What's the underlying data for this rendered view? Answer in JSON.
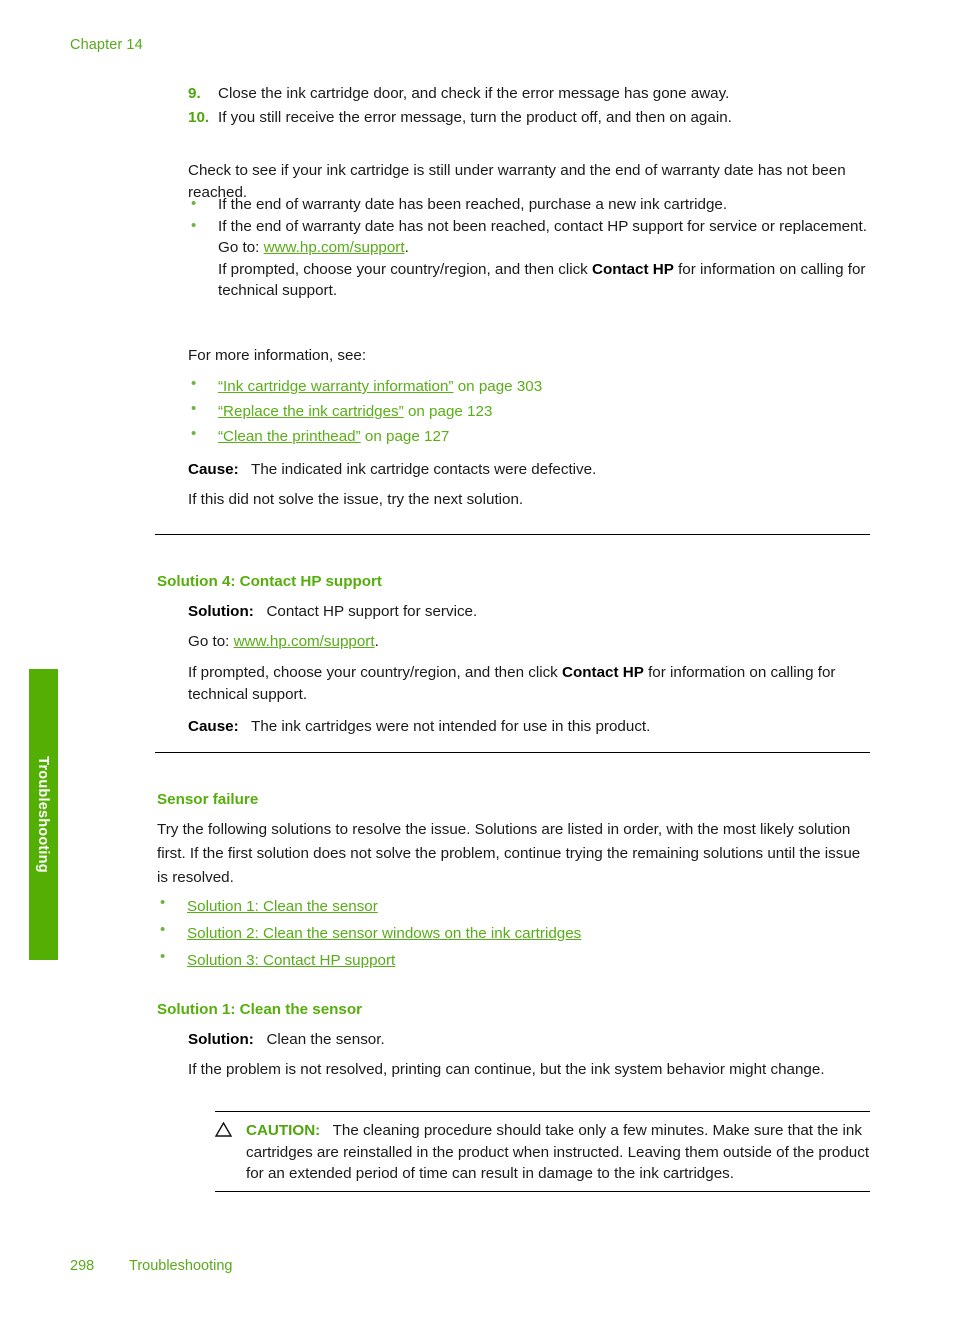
{
  "page": {
    "chapter_header": "Chapter 14",
    "side_tab_label": "Troubleshooting",
    "footer_page_number": "298",
    "footer_section": "Troubleshooting",
    "colors": {
      "heading_green": "#56ae0c",
      "link_green": "#57ad17",
      "tab_green": "#54af04",
      "header_green": "#5aa91b",
      "body_black": "#1a1a1a"
    }
  },
  "steps": [
    {
      "number": "9.",
      "text": "Close the ink cartridge door, and check if the error message has gone away."
    },
    {
      "number": "10.",
      "text": "If you still receive the error message, turn the product off, and then on again."
    }
  ],
  "warranty": {
    "intro": "Check to see if your ink cartridge is still under warranty and the end of warranty date has not been reached.",
    "bullets": [
      {
        "text": "If the end of warranty date has been reached, purchase a new ink cartridge."
      },
      {
        "text": "If the end of warranty date has not been reached, contact HP support for service or replacement.",
        "goto_prefix": "Go to: ",
        "goto_link": "www.hp.com/support",
        "goto_suffix": ".",
        "prompt_prefix": "If prompted, choose your country/region, and then click ",
        "prompt_bold": "Contact HP",
        "prompt_suffix": " for information on calling for technical support."
      }
    ]
  },
  "more_info": {
    "intro": "For more information, see:",
    "items": [
      {
        "quoted": "“Ink cartridge warranty information”",
        "suffix": " on page 303"
      },
      {
        "quoted": "“Replace the ink cartridges”",
        "suffix": " on page 123"
      },
      {
        "quoted": "“Clean the printhead”",
        "suffix": " on page 127"
      }
    ]
  },
  "cause_1": {
    "label": "Cause:",
    "text": "The indicated ink cartridge contacts were defective."
  },
  "next_solution_1": "If this did not solve the issue, try the next solution.",
  "solution_4": {
    "heading": "Solution 4: Contact HP support",
    "solution_label": "Solution:",
    "solution_text": "Contact HP support for service.",
    "goto_prefix": "Go to: ",
    "goto_link": "www.hp.com/support",
    "goto_suffix": ".",
    "prompt_prefix": "If prompted, choose your country/region, and then click ",
    "prompt_bold": "Contact HP",
    "prompt_suffix": " for information on calling for technical support.",
    "cause_label": "Cause:",
    "cause_text": "The ink cartridges were not intended for use in this product."
  },
  "sensor_failure": {
    "heading": "Sensor failure",
    "intro": "Try the following solutions to resolve the issue. Solutions are listed in order, with the most likely solution first. If the first solution does not solve the problem, continue trying the remaining solutions until the issue is resolved.",
    "links": [
      "Solution 1: Clean the sensor",
      "Solution 2: Clean the sensor windows on the ink cartridges",
      "Solution 3: Contact HP support"
    ]
  },
  "solution_1": {
    "heading": "Solution 1: Clean the sensor",
    "solution_label": "Solution:",
    "solution_text": "Clean the sensor.",
    "note": "If the problem is not resolved, printing can continue, but the ink system behavior might change."
  },
  "caution": {
    "icon": "warning-triangle-icon",
    "label": "CAUTION:",
    "text": "The cleaning procedure should take only a few minutes. Make sure that the ink cartridges are reinstalled in the product when instructed. Leaving them outside of the product for an extended period of time can result in damage to the ink cartridges."
  }
}
